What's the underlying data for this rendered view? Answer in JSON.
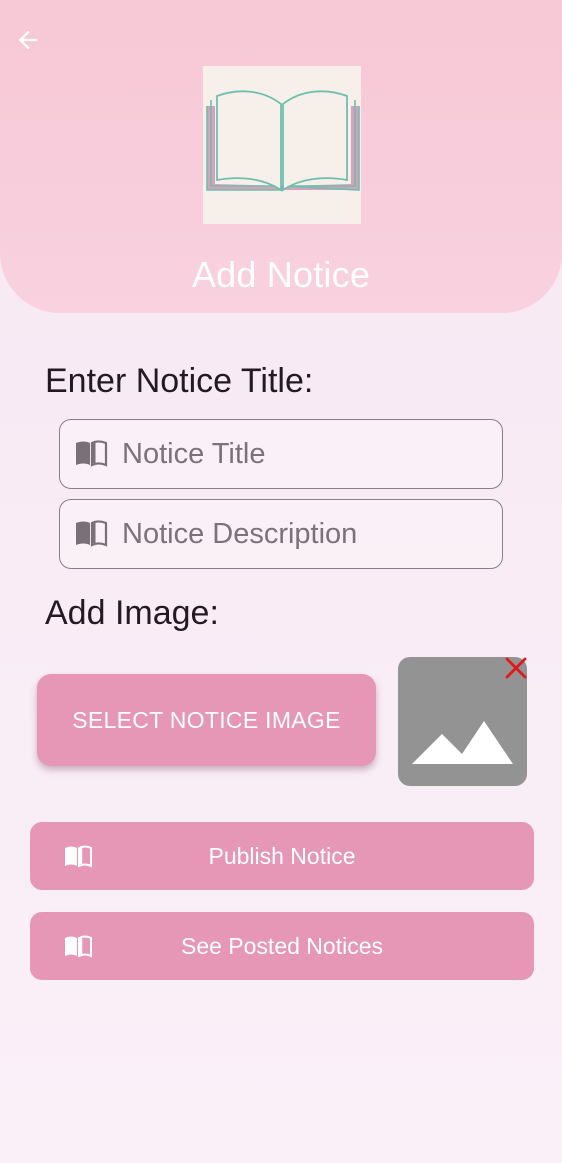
{
  "header": {
    "title": "Add Notice",
    "back_icon": "arrow-left-icon",
    "logo_icon": "open-book-icon",
    "colors": {
      "header_bg": "#f8cbd9",
      "logo_bg": "#f7efea",
      "book_outline": "#6fbfb0",
      "book_back": "#d8a1b9"
    }
  },
  "form": {
    "title_section_label": "Enter Notice Title:",
    "title_field": {
      "placeholder": "Notice Title",
      "value": "",
      "icon": "book-icon"
    },
    "description_field": {
      "placeholder": "Notice Description",
      "value": "",
      "icon": "book-icon"
    },
    "image_section_label": "Add Image:",
    "select_image_label": "SELECT NOTICE IMAGE",
    "image_placeholder_icon": "image-icon",
    "remove_image_icon": "close-icon"
  },
  "actions": {
    "publish": {
      "label": "Publish Notice",
      "icon": "book-icon"
    },
    "see_posted": {
      "label": "See Posted Notices",
      "icon": "book-icon"
    }
  },
  "colors": {
    "accent": "#e597b5",
    "text_dark": "#231a24",
    "remove_red": "#e0191d",
    "preview_gray": "#939393"
  }
}
